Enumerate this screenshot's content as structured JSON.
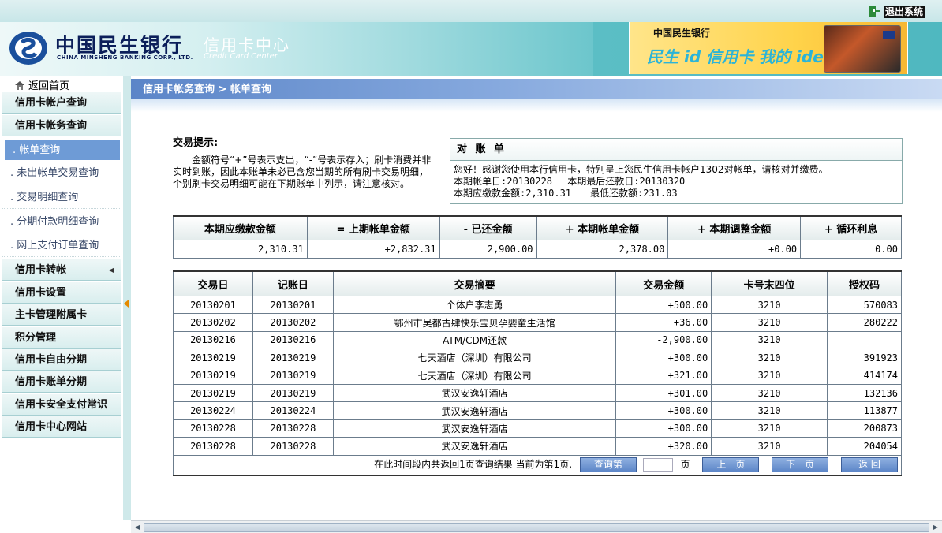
{
  "topbar": {
    "exit_label": "退出系统"
  },
  "header": {
    "bank_name": "中国民生银行",
    "bank_name_en": "CHINA MINSHENG BANKING CORP., LTD.",
    "center_cn": "信用卡中心",
    "center_en": "Credit Card Center",
    "banner_bank": "中国民生银行",
    "banner_slogan": "民生 id 信用卡 我的 idea"
  },
  "sidebar": {
    "home_label": "返回首页",
    "groups": [
      {
        "label": "信用卡帐户查询"
      },
      {
        "label": "信用卡帐务查询"
      }
    ],
    "sub_items": [
      {
        "label": ". 帐单查询",
        "active": true
      },
      {
        "label": ". 未出帐单交易查询"
      },
      {
        "label": ". 交易明细查询"
      },
      {
        "label": ". 分期付款明细查询"
      },
      {
        "label": ". 网上支付订单查询"
      }
    ],
    "more_groups": [
      {
        "label": "信用卡转帐"
      },
      {
        "label": "信用卡设置"
      },
      {
        "label": "主卡管理附属卡"
      },
      {
        "label": "积分管理"
      },
      {
        "label": "信用卡自由分期"
      },
      {
        "label": "信用卡账单分期"
      },
      {
        "label": "信用卡安全支付常识"
      },
      {
        "label": "信用卡中心网站"
      }
    ]
  },
  "breadcrumb": "信用卡帐务查询 > 帐单查询",
  "tip": {
    "title": "交易提示:",
    "text": "金额符号“+”号表示支出，“-”号表示存入；刷卡消费并非实时到账，因此本账单未必已含您当期的所有刷卡交易明细，个别刷卡交易明细可能在下期账单中列示，请注意核对。"
  },
  "statement": {
    "title": "对 账 单",
    "line1": "您好！感谢您使用本行信用卡，特别呈上您民生信用卡帐户1302对帐单，请核对并缴费。",
    "line2": "本期帐单日:20130228　 本期最后还款日:20130320",
    "line3": "本期应缴款金额:2,310.31　　最低还款额:231.03"
  },
  "summary": {
    "headers": [
      "本期应缴款金额",
      "= 上期帐单金额",
      "- 已还金额",
      "+ 本期帐单金额",
      "+ 本期调整金额",
      "+ 循环利息"
    ],
    "values": [
      "2,310.31",
      "+2,832.31",
      "2,900.00",
      "2,378.00",
      "+0.00",
      "0.00"
    ]
  },
  "transactions": {
    "headers": [
      "交易日",
      "记账日",
      "交易摘要",
      "交易金额",
      "卡号末四位",
      "授权码"
    ],
    "rows": [
      [
        "20130201",
        "20130201",
        "个体户李志勇",
        "+500.00",
        "3210",
        "570083"
      ],
      [
        "20130202",
        "20130202",
        "鄂州市吴都古肆快乐宝贝孕婴童生活馆",
        "+36.00",
        "3210",
        "280222"
      ],
      [
        "20130216",
        "20130216",
        "ATM/CDM还款",
        "-2,900.00",
        "3210",
        ""
      ],
      [
        "20130219",
        "20130219",
        "七天酒店（深圳）有限公司",
        "+300.00",
        "3210",
        "391923"
      ],
      [
        "20130219",
        "20130219",
        "七天酒店（深圳）有限公司",
        "+321.00",
        "3210",
        "414174"
      ],
      [
        "20130219",
        "20130219",
        "武汉安逸轩酒店",
        "+301.00",
        "3210",
        "132136"
      ],
      [
        "20130224",
        "20130224",
        "武汉安逸轩酒店",
        "+300.00",
        "3210",
        "113877"
      ],
      [
        "20130228",
        "20130228",
        "武汉安逸轩酒店",
        "+300.00",
        "3210",
        "200873"
      ],
      [
        "20130228",
        "20130228",
        "武汉安逸轩酒店",
        "+320.00",
        "3210",
        "204054"
      ]
    ]
  },
  "pager": {
    "info": "在此时间段内共返回1页查询结果  当前为第1页,",
    "query_page": "查询第",
    "page_unit": "页",
    "prev": "上一页",
    "next": "下一页",
    "back": "返 回"
  },
  "colors": {
    "accent": "#5b85c8",
    "header_teal": "#4fb8c0",
    "active_nav": "#6e9bd6"
  }
}
